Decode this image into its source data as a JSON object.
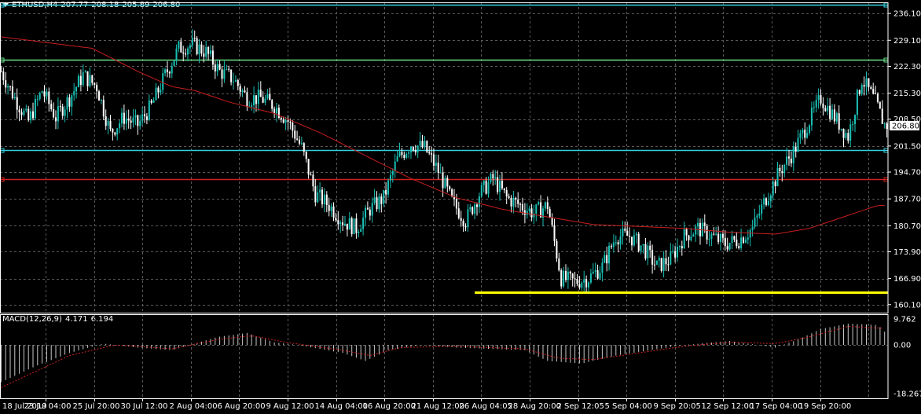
{
  "header": {
    "symbol": "ETHUSD,H4",
    "open": "207.77",
    "high": "208.18",
    "low": "205.89",
    "close": "206.80"
  },
  "macd_header": {
    "name": "MACD(12,26,9)",
    "main": "4.171",
    "signal": "6.194"
  },
  "colors": {
    "background": "#000000",
    "grid": "#5a5a5a",
    "bull_candle": "#19c0b4",
    "bear_candle": "#ffffff",
    "moving_average": "#c81e1e",
    "hline_cyan": "#33d0e0",
    "hline_green": "#66dd88",
    "hline_red": "#d02020",
    "hline_yellow": "#ffff00",
    "macd_bars": "#c8c8c8",
    "macd_signal": "#d02020"
  },
  "chart_data": [
    {
      "type": "candlestick",
      "panel": "price",
      "y_axis_ticks": [
        "236.10",
        "229.10",
        "222.30",
        "215.30",
        "208.50",
        "201.50",
        "194.70",
        "187.70",
        "180.70",
        "173.90",
        "166.90",
        "160.10"
      ],
      "ylim": [
        158,
        239
      ],
      "current_price_label": "206.80",
      "x_axis_labels": [
        "18 Jul 2019",
        "23 Jul 04:00",
        "25 Jul 20:00",
        "30 Jul 12:00",
        "2 Aug 04:00",
        "6 Aug 20:00",
        "9 Aug 12:00",
        "14 Aug 04:00",
        "16 Aug 20:00",
        "21 Aug 12:00",
        "26 Aug 04:05",
        "28 Aug 20:00",
        "2 Sep 12:05",
        "5 Sep 04:00",
        "9 Sep 20:05",
        "12 Sep 12:00",
        "17 Sep 04:00",
        "19 Sep 20:00"
      ],
      "close_path": [
        [
          0,
          221
        ],
        [
          6,
          214
        ],
        [
          12,
          208
        ],
        [
          18,
          216
        ],
        [
          24,
          209
        ],
        [
          30,
          214
        ],
        [
          36,
          220
        ],
        [
          42,
          217
        ],
        [
          48,
          205
        ],
        [
          54,
          209
        ],
        [
          60,
          207
        ],
        [
          66,
          212
        ],
        [
          72,
          220
        ],
        [
          78,
          227
        ],
        [
          84,
          228
        ],
        [
          90,
          226
        ],
        [
          96,
          221
        ],
        [
          102,
          219
        ],
        [
          108,
          214
        ],
        [
          114,
          214
        ],
        [
          120,
          212
        ],
        [
          126,
          208
        ],
        [
          132,
          201
        ],
        [
          138,
          189
        ],
        [
          144,
          186
        ],
        [
          150,
          182
        ],
        [
          156,
          180
        ],
        [
          162,
          185
        ],
        [
          168,
          188
        ],
        [
          174,
          198
        ],
        [
          180,
          202
        ],
        [
          186,
          201
        ],
        [
          192,
          195
        ],
        [
          198,
          187
        ],
        [
          204,
          182
        ],
        [
          210,
          189
        ],
        [
          216,
          193
        ],
        [
          222,
          188
        ],
        [
          228,
          186
        ],
        [
          234,
          184
        ],
        [
          240,
          186
        ],
        [
          246,
          167
        ],
        [
          252,
          166
        ],
        [
          258,
          167
        ],
        [
          264,
          170
        ],
        [
          270,
          178
        ],
        [
          276,
          178
        ],
        [
          282,
          175
        ],
        [
          288,
          170
        ],
        [
          294,
          172
        ],
        [
          300,
          178
        ],
        [
          306,
          180
        ],
        [
          312,
          178
        ],
        [
          318,
          176
        ],
        [
          324,
          177
        ],
        [
          330,
          180
        ],
        [
          336,
          188
        ],
        [
          342,
          195
        ],
        [
          348,
          200
        ],
        [
          354,
          207
        ],
        [
          360,
          214
        ],
        [
          366,
          209
        ],
        [
          372,
          204
        ],
        [
          378,
          219
        ],
        [
          384,
          213
        ],
        [
          388,
          207
        ]
      ],
      "moving_average_path": [
        [
          0,
          230
        ],
        [
          40,
          227
        ],
        [
          60,
          221
        ],
        [
          75,
          217
        ],
        [
          85,
          216
        ],
        [
          100,
          213
        ],
        [
          120,
          210
        ],
        [
          140,
          205
        ],
        [
          160,
          199
        ],
        [
          180,
          193
        ],
        [
          200,
          188
        ],
        [
          220,
          185
        ],
        [
          240,
          183
        ],
        [
          260,
          181
        ],
        [
          280,
          180.5
        ],
        [
          300,
          180
        ],
        [
          320,
          179
        ],
        [
          340,
          178.5
        ],
        [
          355,
          180
        ],
        [
          370,
          183
        ],
        [
          385,
          186
        ]
      ],
      "horizontal_lines": [
        {
          "price": 238.3,
          "color": "#33d0e0"
        },
        {
          "price": 224.0,
          "color": "#66dd88"
        },
        {
          "price": 200.5,
          "color": "#33d0e0"
        },
        {
          "price": 192.8,
          "color": "#d02020"
        },
        {
          "price": 163.3,
          "color": "#ffff00",
          "x_start_bar": 208
        }
      ]
    },
    {
      "type": "macd",
      "panel": "indicator",
      "y_axis_ticks": [
        "9.762",
        "0.00",
        "-18.267"
      ],
      "ylim": [
        -18.267,
        9.762
      ],
      "histogram_path": [
        [
          0,
          -14
        ],
        [
          15,
          -8
        ],
        [
          30,
          -3
        ],
        [
          45,
          0.5
        ],
        [
          60,
          -1
        ],
        [
          75,
          -2
        ],
        [
          95,
          3
        ],
        [
          108,
          4.5
        ],
        [
          120,
          1
        ],
        [
          130,
          0
        ],
        [
          150,
          -3
        ],
        [
          160,
          -6
        ],
        [
          170,
          -2
        ],
        [
          185,
          0
        ],
        [
          200,
          -1
        ],
        [
          230,
          -2
        ],
        [
          240,
          -6
        ],
        [
          255,
          -7
        ],
        [
          270,
          -4
        ],
        [
          285,
          -2
        ],
        [
          300,
          0
        ],
        [
          320,
          1.5
        ],
        [
          340,
          -1
        ],
        [
          350,
          2
        ],
        [
          360,
          6
        ],
        [
          372,
          8
        ],
        [
          385,
          7.5
        ],
        [
          388,
          5
        ]
      ],
      "signal_path": [
        [
          0,
          -16
        ],
        [
          15,
          -10
        ],
        [
          30,
          -4
        ],
        [
          50,
          0
        ],
        [
          60,
          -0.5
        ],
        [
          75,
          -1.5
        ],
        [
          95,
          2
        ],
        [
          110,
          3.5
        ],
        [
          125,
          1
        ],
        [
          150,
          -2
        ],
        [
          162,
          -4
        ],
        [
          175,
          -1
        ],
        [
          200,
          -0.5
        ],
        [
          230,
          -1.5
        ],
        [
          245,
          -5
        ],
        [
          260,
          -5.5
        ],
        [
          280,
          -3
        ],
        [
          300,
          -0.5
        ],
        [
          320,
          1
        ],
        [
          340,
          0.5
        ],
        [
          355,
          3
        ],
        [
          372,
          7
        ],
        [
          388,
          6.2
        ]
      ]
    }
  ]
}
